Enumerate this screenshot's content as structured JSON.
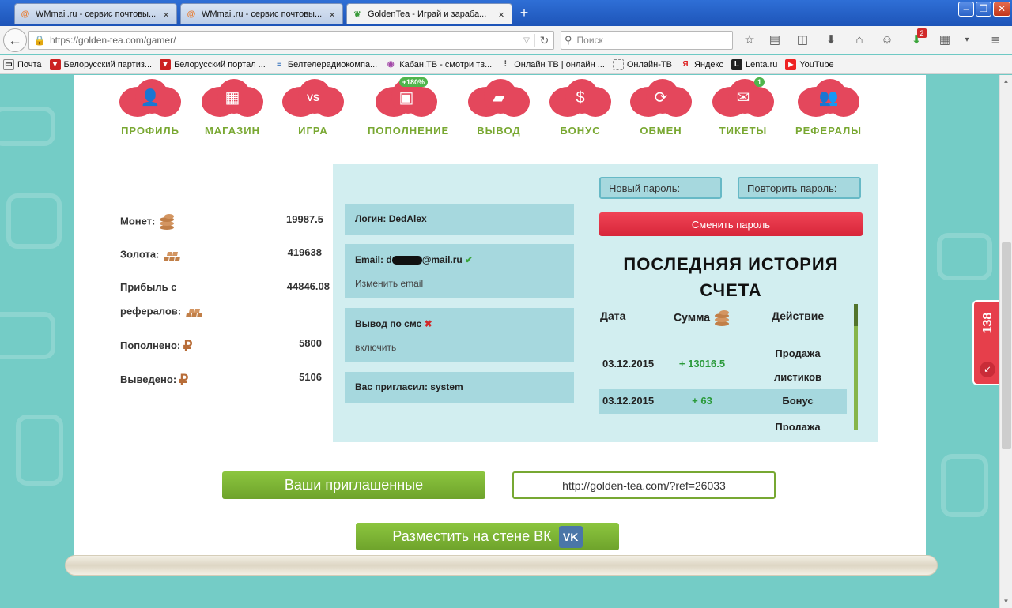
{
  "browser": {
    "tabs": [
      {
        "title": "WMmail.ru - сервис почтовы...",
        "icon": "wmmail-icon"
      },
      {
        "title": "WMmail.ru - сервис почтовы...",
        "icon": "wmmail-icon"
      },
      {
        "title": "GoldenTea - Играй и зараба...",
        "icon": "goldentea-leaf-icon"
      }
    ],
    "url": "https://golden-tea.com/gamer/",
    "search_placeholder": "Поиск",
    "bookmarks": [
      {
        "label": "Почта",
        "icon": "mail-icon"
      },
      {
        "label": "Белорусский партиз...",
        "icon": "shield-icon"
      },
      {
        "label": "Белорусский портал ...",
        "icon": "tut-icon"
      },
      {
        "label": "Белтелерадиокомпа...",
        "icon": "btrc-icon"
      },
      {
        "label": "Кабан.ТВ - смотри тв...",
        "icon": "kaban-icon"
      },
      {
        "label": "Онлайн ТВ | онлайн ...",
        "icon": "tv-tower-icon"
      },
      {
        "label": "Онлайн-ТВ",
        "icon": "page-icon"
      },
      {
        "label": "Яндекс",
        "icon": "yandex-icon"
      },
      {
        "label": "Lenta.ru",
        "icon": "lenta-icon"
      },
      {
        "label": "YouTube",
        "icon": "youtube-icon"
      }
    ],
    "badge_count": "2"
  },
  "nav": [
    {
      "label": "ПРОФИЛЬ",
      "icon": "profile-icon"
    },
    {
      "label": "МАГАЗИН",
      "icon": "shop-icon"
    },
    {
      "label": "ИГРА",
      "icon": "game-vs-icon"
    },
    {
      "label": "ПОПОЛНЕНИЕ",
      "icon": "deposit-icon",
      "badge": "+180%"
    },
    {
      "label": "ВЫВОД",
      "icon": "wallet-icon"
    },
    {
      "label": "БОНУС",
      "icon": "dollar-icon"
    },
    {
      "label": "ОБМЕН",
      "icon": "exchange-icon"
    },
    {
      "label": "ТИКЕТЫ",
      "icon": "envelope-icon",
      "badge": "1"
    },
    {
      "label": "РЕФЕРАЛЫ",
      "icon": "referrals-icon"
    }
  ],
  "stats": {
    "coins_label": "Монет:",
    "coins_value": "19987.5",
    "gold_label": "Золота:",
    "gold_value": "419638",
    "ref_profit_label_1": "Прибыль с",
    "ref_profit_label_2": "рефералов:",
    "ref_profit_value": "44846.08",
    "deposited_label": "Пополнено:",
    "deposited_value": "5800",
    "withdrawn_label": "Выведено:",
    "withdrawn_value": "5106",
    "rub_symbol": "₽"
  },
  "account": {
    "login": "Логин: DedAlex",
    "email_prefix": "Email: d",
    "email_suffix": "@mail.ru",
    "change_email": "Изменить email",
    "sms_label": "Вывод по смс",
    "sms_enable": "включить",
    "invited_by": "Вас пригласил: system"
  },
  "password": {
    "new_placeholder": "Новый пароль:",
    "repeat_placeholder": "Повторить пароль:",
    "change_button": "Сменить пароль"
  },
  "history": {
    "title_line1": "ПОСЛЕДНЯЯ ИСТОРИЯ",
    "title_line2": "СЧЕТА",
    "col_date": "Дата",
    "col_sum": "Сумма",
    "col_action": "Действие",
    "rows": [
      {
        "date": "03.12.2015",
        "sum": "+ 13016.5",
        "action_1": "Продажа",
        "action_2": "листиков"
      },
      {
        "date": "03.12.2015",
        "sum": "+ 63",
        "action_1": "Бонус",
        "action_2": ""
      },
      {
        "date": "",
        "sum": "",
        "action_1": "Продажа",
        "action_2": ""
      }
    ]
  },
  "bottom": {
    "invited_button": "Ваши приглашенные",
    "ref_link": "http://golden-tea.com/?ref=26033",
    "vk_button": "Разместить на стене ВК",
    "vk_glyph": "VK"
  },
  "side_tab": {
    "label": "138"
  }
}
